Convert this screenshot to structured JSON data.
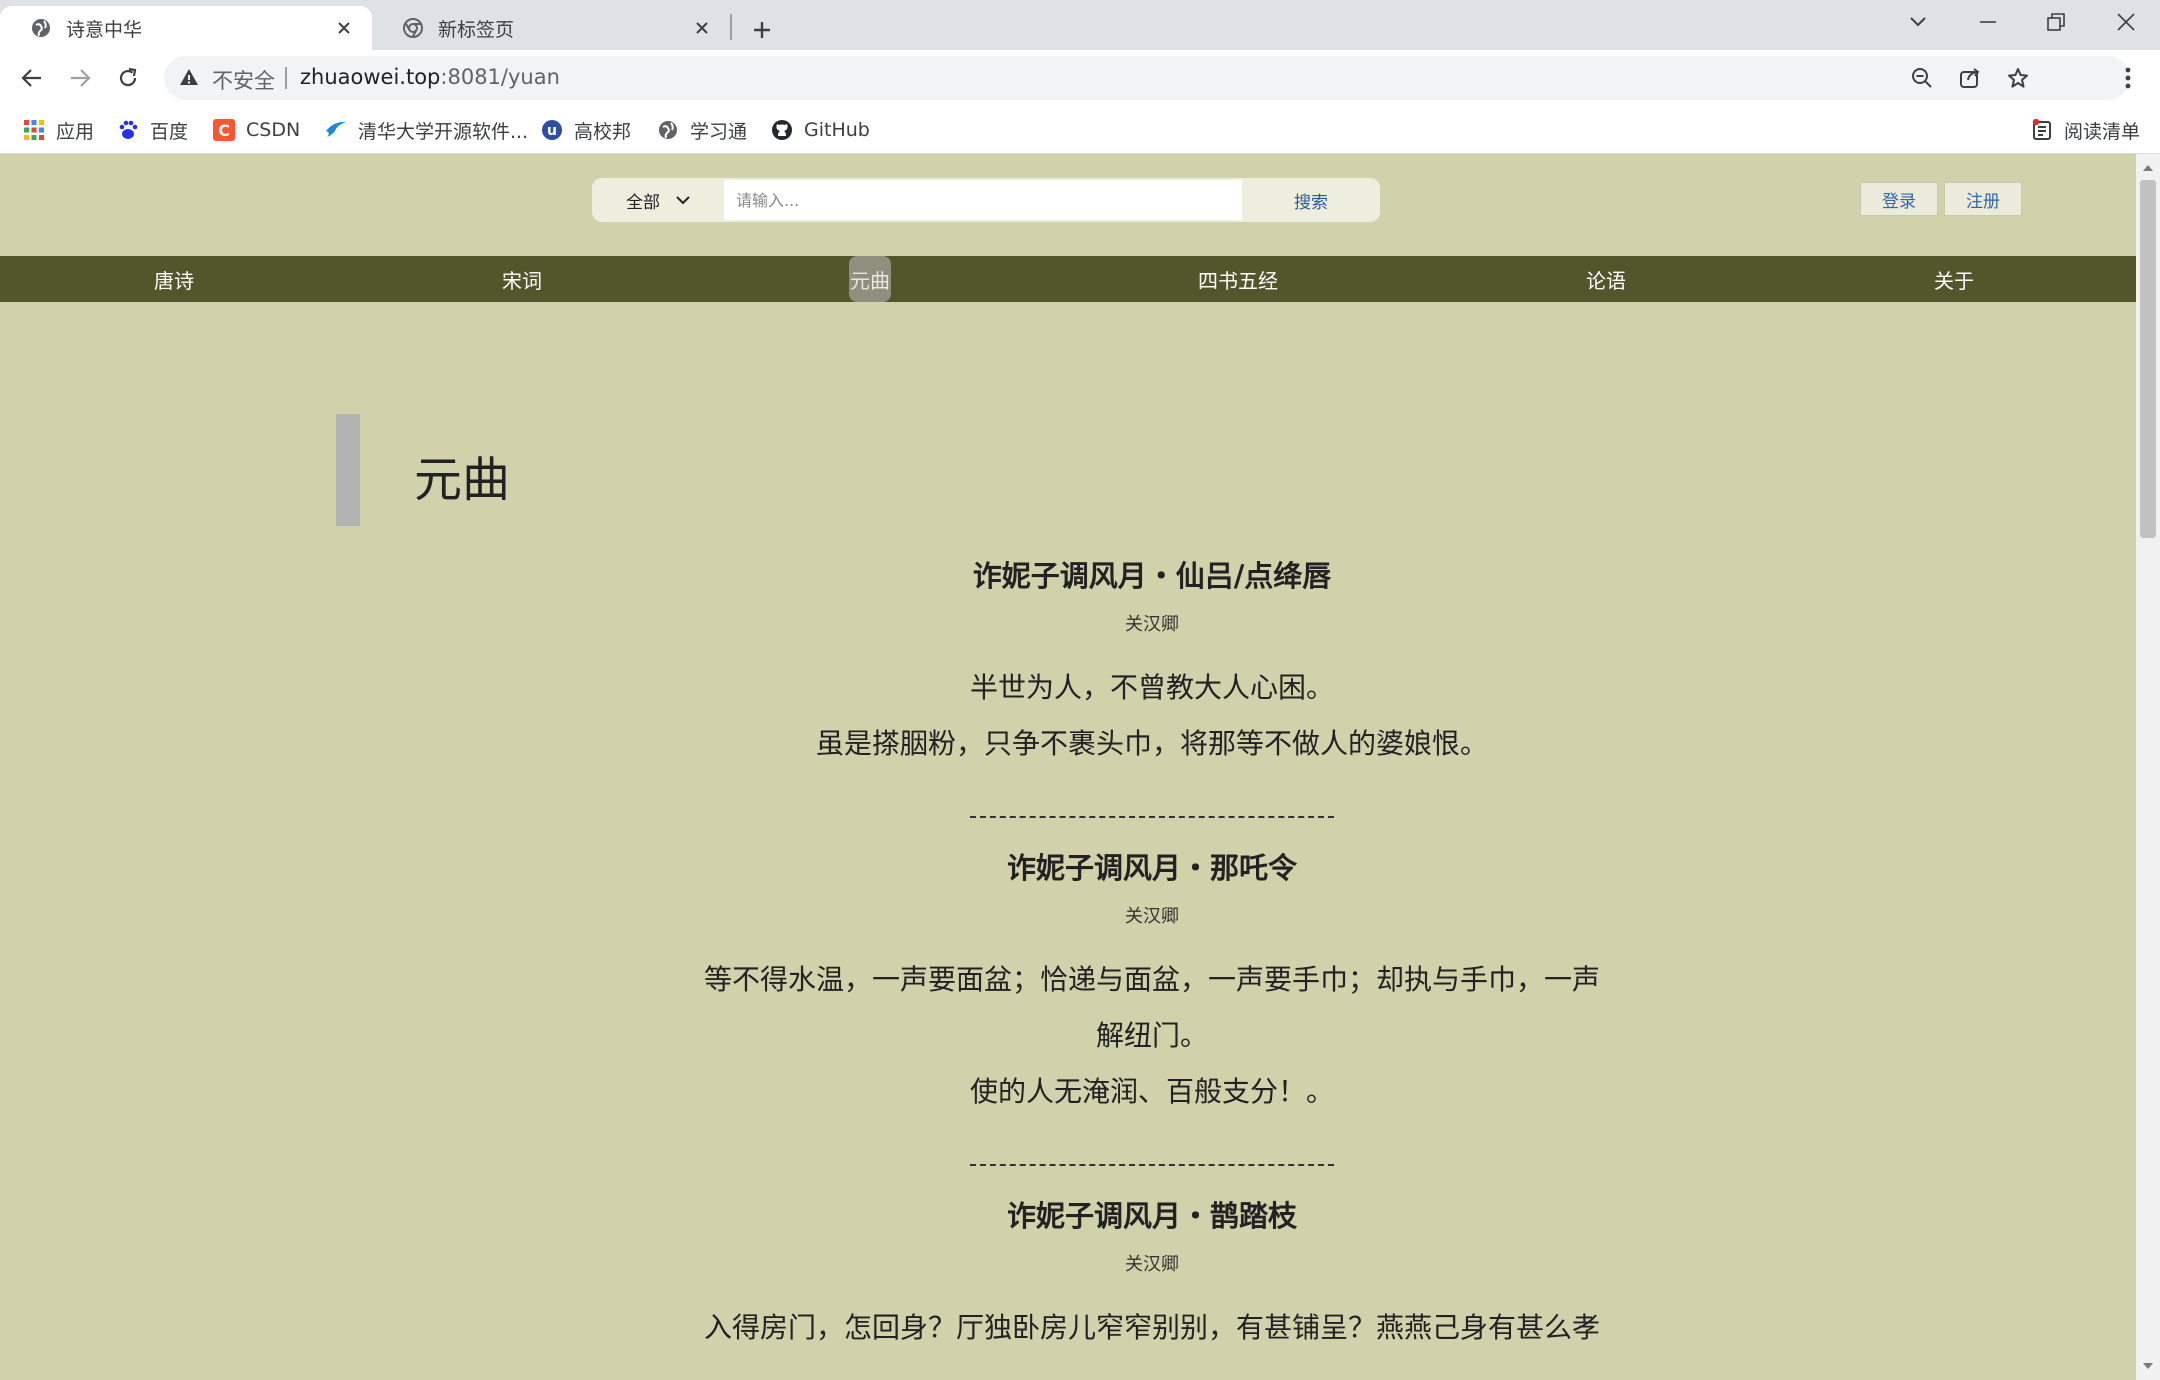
{
  "browser": {
    "tabs": [
      {
        "title": "诗意中华",
        "active": true
      },
      {
        "title": "新标签页",
        "active": false
      }
    ],
    "address": {
      "security_label": "不安全",
      "host": "zhuaowei.top",
      "path": ":8081/yuan"
    },
    "bookmarks": [
      {
        "label": "应用",
        "icon": "apps-grid-icon"
      },
      {
        "label": "百度",
        "icon": "baidu-paw-icon"
      },
      {
        "label": "CSDN",
        "icon": "csdn-icon"
      },
      {
        "label": "清华大学开源软件...",
        "icon": "tsinghua-mirror-icon"
      },
      {
        "label": "高校邦",
        "icon": "gaoxiaobang-icon"
      },
      {
        "label": "学习通",
        "icon": "globe-icon"
      },
      {
        "label": "GitHub",
        "icon": "github-icon"
      }
    ],
    "reading_list": "阅读清单"
  },
  "site": {
    "search": {
      "category": "全部",
      "placeholder": "请输入...",
      "button": "搜索"
    },
    "auth": {
      "login": "登录",
      "register": "注册"
    },
    "nav": [
      "唐诗",
      "宋词",
      "元曲",
      "四书五经",
      "论语",
      "关于"
    ],
    "active_nav": "元曲",
    "section_title": "元曲",
    "divider": "----------------------------------------------------------",
    "poems": [
      {
        "title": "诈妮子调风月・仙吕/点绛唇",
        "author": "关汉卿",
        "lines": [
          "半世为人，不曾教大人心困。",
          "虽是搽胭粉，只争不裹头巾，将那等不做人的婆娘恨。"
        ]
      },
      {
        "title": "诈妮子调风月・那吒令",
        "author": "关汉卿",
        "lines": [
          "等不得水温，一声要面盆；恰递与面盆，一声要手巾；却执与手巾，一声",
          "解纽门。",
          "使的人无淹润、百般支分！。"
        ]
      },
      {
        "title": "诈妮子调风月・鹊踏枝",
        "author": "关汉卿",
        "lines": [
          "入得房门，怎回身？厅独卧房儿窄窄别别，有甚铺呈？燕燕己身有甚么孝"
        ]
      }
    ]
  },
  "colors": {
    "page_bg": "#d1d1ab",
    "nav_bg": "#53562b",
    "nav_active_bg": "#8e8f7d",
    "section_marker": "#b3b3b3"
  }
}
